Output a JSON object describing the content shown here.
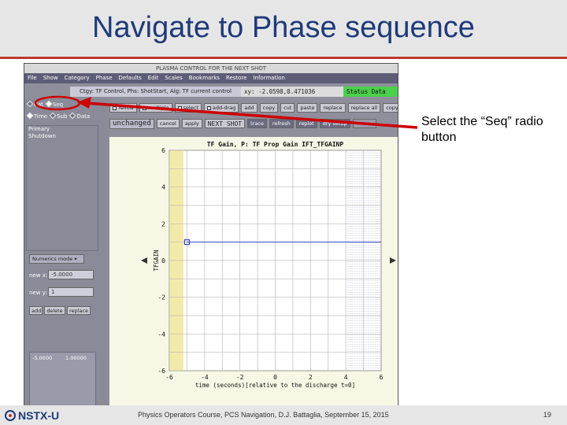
{
  "slide": {
    "title": "Navigate to Phase sequence",
    "callout": "Select the “Seq” radio button",
    "footer": "Physics Operators Course, PCS Navigation, D.J. Battaglia, September 15, 2015",
    "page_number": "19",
    "logo": "NSTX-U"
  },
  "app": {
    "window_title": "PLASMA CONTROL FOR THE NEXT SHOT",
    "menu": [
      "File",
      "Show",
      "Category",
      "Phase",
      "Defaults",
      "Edit",
      "Scales",
      "Bookmarks",
      "Restore",
      "Information"
    ],
    "info_line": "Ctgy: TF Control, Phs: ShotStart, Alg: TF current control",
    "xy_readout": "xy: -2.0598,0.471036",
    "status": "Status Data",
    "radio_row1": {
      "cat_label": "Cat",
      "seq_label": "Seq"
    },
    "radio_row2": {
      "time_label": "Time",
      "sub_label": "Sub",
      "data_label": "Data"
    },
    "phase_list": [
      "Primary",
      "Shutdown"
    ],
    "toolbar1": [
      "Yellow",
      "multiple",
      "select",
      "add-drag",
      "add",
      "copy",
      "cut",
      "paste",
      "replace",
      "replace all",
      "copy all"
    ],
    "toolbar2": [
      "unchanged",
      "cancel",
      "apply",
      "NEXT SHOT",
      "trace",
      "refresh",
      "replot",
      "dry setup",
      ""
    ],
    "numerics_mode": "Numerics mode",
    "new_x_label": "new x:",
    "new_x_value": "-5.0000",
    "new_y_label": "new y:",
    "new_y_value": "1",
    "edit_buttons": [
      "add",
      "delete",
      "replace"
    ],
    "values": [
      "-5.0000",
      "1.00000"
    ]
  },
  "chart_data": {
    "type": "line",
    "title": "TF Gain, P: TF Prop Gain IFT_TFGAINP",
    "xlabel": "time (seconds)[relative to the discharge t=0]",
    "ylabel": "TFGAIN",
    "xlim": [
      -6,
      6
    ],
    "ylim": [
      -6,
      6
    ],
    "xticks": [
      "-6",
      "-4",
      "-2",
      "0",
      "2",
      "4",
      "6"
    ],
    "yticks": [
      "6",
      "4",
      "2",
      "0",
      "-2",
      "-4",
      "-6"
    ],
    "series": [
      {
        "values": [
          {
            "x": -5.0,
            "y": 1.0
          },
          {
            "x": 6.0,
            "y": 1.0
          }
        ]
      }
    ],
    "grid": true
  }
}
